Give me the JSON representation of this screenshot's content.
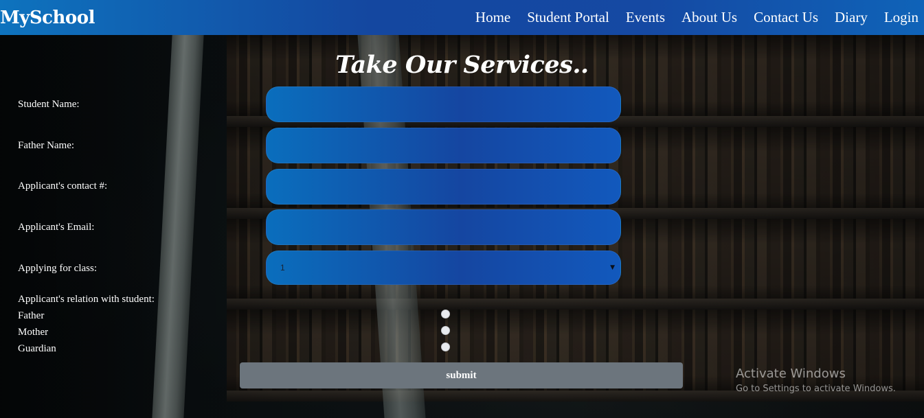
{
  "navbar": {
    "brand": "MySchool",
    "links": [
      "Home",
      "Student Portal",
      "Events",
      "About Us",
      "Contact Us",
      "Diary",
      "Login"
    ]
  },
  "form": {
    "heading": "Take Our Services..",
    "fields": {
      "student_name": {
        "label": "Student Name:",
        "value": ""
      },
      "father_name": {
        "label": "Father Name:",
        "value": ""
      },
      "contact": {
        "label": "Applicant's contact #:",
        "value": ""
      },
      "email": {
        "label": "Applicant's Email:",
        "value": ""
      }
    },
    "class_select": {
      "label": "Applying for class:",
      "selected": "1"
    },
    "relation": {
      "label": "Applicant's relation with student:",
      "options": [
        "Father",
        "Mother",
        "Guardian"
      ]
    },
    "submit_label": "submit"
  },
  "watermark": {
    "title": "Activate Windows",
    "subtitle": "Go to Settings to activate Windows."
  },
  "colors": {
    "navbar_start": "#0e73be",
    "navbar_mid": "#1447a0",
    "input_start": "#0a6ebd",
    "input_mid": "#1546a1",
    "submit_bg": "#6c757d"
  }
}
